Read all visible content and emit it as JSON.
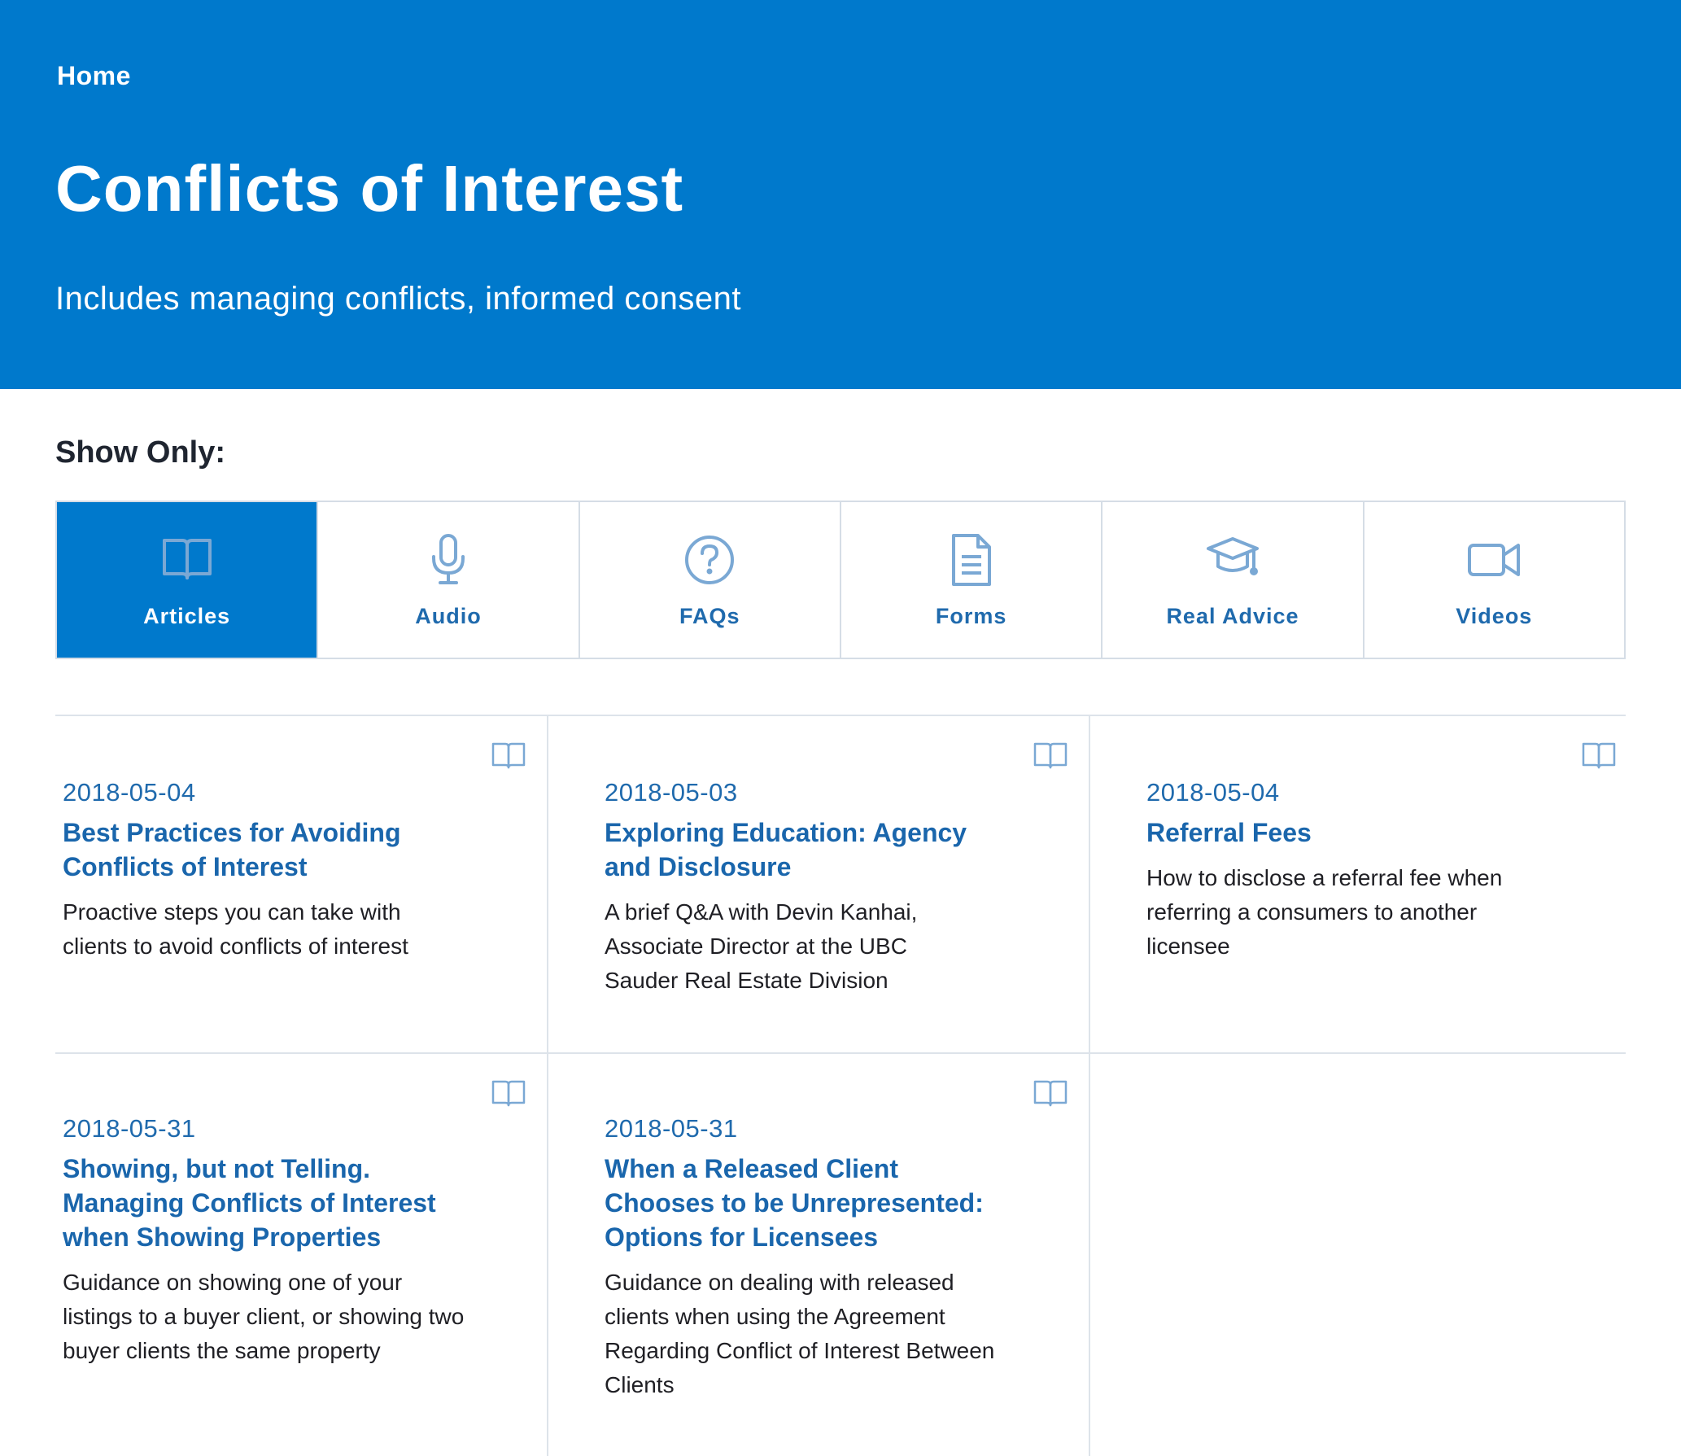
{
  "breadcrumb": {
    "home": "Home"
  },
  "page": {
    "title": "Conflicts of Interest",
    "subtitle": "Includes managing conflicts, informed consent"
  },
  "filters": {
    "heading": "Show Only:",
    "items": [
      {
        "label": "Articles",
        "icon": "book-icon",
        "active": true
      },
      {
        "label": "Audio",
        "icon": "microphone-icon",
        "active": false
      },
      {
        "label": "FAQs",
        "icon": "question-icon",
        "active": false
      },
      {
        "label": "Forms",
        "icon": "document-icon",
        "active": false
      },
      {
        "label": "Real Advice",
        "icon": "graduation-cap-icon",
        "active": false
      },
      {
        "label": "Videos",
        "icon": "video-camera-icon",
        "active": false
      }
    ]
  },
  "articles": [
    {
      "date": "2018-05-04",
      "title": "Best Practices for Avoiding Conflicts of Interest",
      "description": "Proactive steps you can take with clients to avoid conflicts of interest"
    },
    {
      "date": "2018-05-03",
      "title": "Exploring Education: Agency and Disclosure",
      "description": "A brief Q&A with Devin Kanhai, Associate Director at the UBC Sauder Real Estate Division"
    },
    {
      "date": "2018-05-04",
      "title": "Referral Fees",
      "description": "How to disclose a referral fee when referring a consumers to another licensee"
    },
    {
      "date": "2018-05-31",
      "title": "Showing, but not Telling. Managing Conflicts of Interest when Showing Properties",
      "description": "Guidance on showing one of your listings to a buyer client, or showing two buyer clients the same property"
    },
    {
      "date": "2018-05-31",
      "title": "When a Released Client Chooses to be Unrepresented: Options for Licensees",
      "description": "Guidance on dealing with released clients when using the Agreement Regarding Conflict of Interest Between Clients"
    }
  ],
  "colors": {
    "brand_blue": "#0079cc",
    "link_blue": "#1a66ac",
    "icon_light_blue": "#7aa8d4",
    "border": "#d5dde6"
  }
}
